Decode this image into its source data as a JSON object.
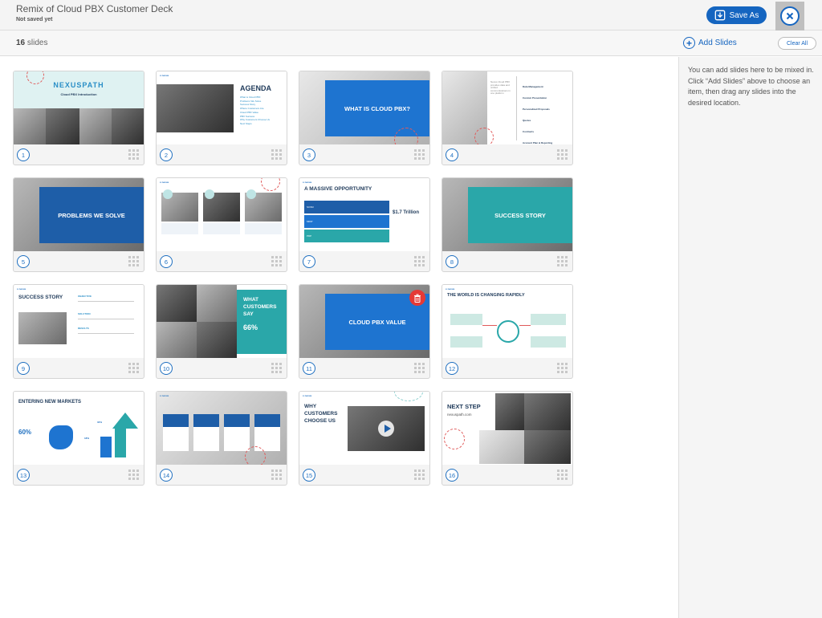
{
  "header": {
    "title": "Remix of Cloud PBX Customer Deck",
    "subtitle": "Not saved yet",
    "save_as_label": "Save As",
    "close_icon": "close-icon"
  },
  "subbar": {
    "slide_count": "16",
    "slide_count_suffix": " slides",
    "add_slides_label": "Add Slides",
    "clear_all_label": "Clear All"
  },
  "sidebar": {
    "help_text": "You can add slides here to be mixed in. Click “Add Slides” above to choose an item, then drag any slides into the desired location."
  },
  "colors": {
    "accent_blue": "#1565c0",
    "slide_blue": "#1e5ea8",
    "slide_teal": "#2aa7a9",
    "delete_red": "#e53935"
  },
  "slides": [
    {
      "number": "1",
      "title": "NEXUSPATH",
      "subtitle": "Cloud PBX Introduction"
    },
    {
      "number": "2",
      "title": "AGENDA",
      "items": [
        "What is Cloud PBX",
        "Problems We Solve",
        "Success Story",
        "Where Customers Are",
        "Cloud PBX Value",
        "PBX Success",
        "Why Customers Choose Us",
        "Next Steps"
      ]
    },
    {
      "number": "3",
      "title": "WHAT IS CLOUD PBX?"
    },
    {
      "number": "4",
      "items": [
        "Data Management",
        "Custom Presentation",
        "Personalized Proposals",
        "Quotes",
        "Contracts",
        "Account Plan & Reporting"
      ]
    },
    {
      "number": "5",
      "title": "PROBLEMS WE SOLVE"
    },
    {
      "number": "6"
    },
    {
      "number": "7",
      "title": "A MASSIVE OPPORTUNITY",
      "rows": [
        "SCSM",
        "MIDP",
        "PDP"
      ],
      "stat": "$1.7 Trillion"
    },
    {
      "number": "8",
      "title": "SUCCESS STORY"
    },
    {
      "number": "9",
      "title": "SUCCESS STORY",
      "labels": [
        "OBJECTIVE",
        "SOLUTION",
        "RESULTS"
      ]
    },
    {
      "number": "10",
      "title": "WHAT CUSTOMERS SAY",
      "stat": "66%"
    },
    {
      "number": "11",
      "title": "CLOUD PBX VALUE"
    },
    {
      "number": "12",
      "title": "THE WORLD IS CHANGING RAPIDLY"
    },
    {
      "number": "13",
      "title": "ENTERING NEW MARKETS",
      "stats": [
        "60%",
        "34%",
        "18%"
      ]
    },
    {
      "number": "14"
    },
    {
      "number": "15",
      "title": "WHY CUSTOMERS CHOOSE US"
    },
    {
      "number": "16",
      "title": "NEXT STEP",
      "subtitle": "nexuspath.com"
    }
  ]
}
